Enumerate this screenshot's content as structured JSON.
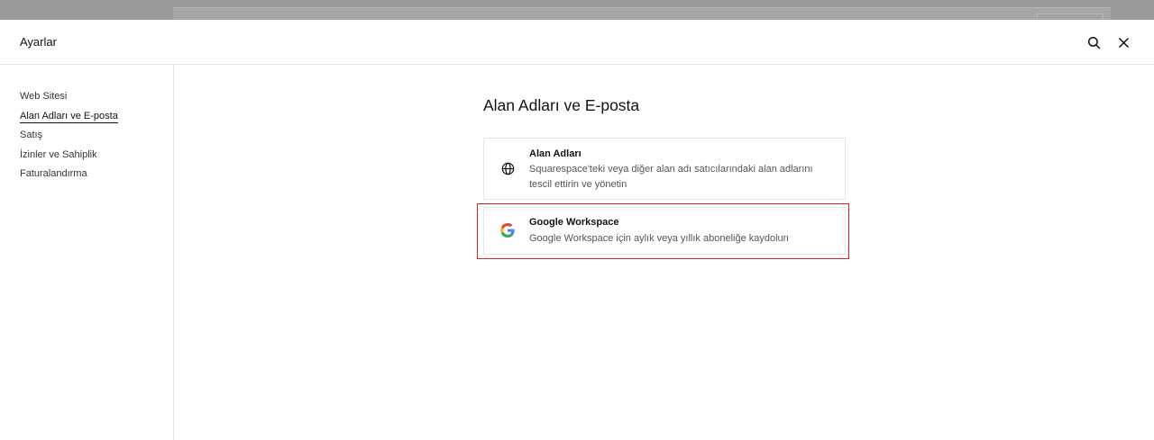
{
  "header": {
    "title": "Ayarlar",
    "search_icon": "search-icon",
    "close_icon": "close-icon"
  },
  "sidebar": {
    "items": [
      {
        "label": "Web Sitesi",
        "active": false
      },
      {
        "label": "Alan Adları ve E-posta",
        "active": true
      },
      {
        "label": "Satış",
        "active": false
      },
      {
        "label": "İzinler ve Sahiplik",
        "active": false
      },
      {
        "label": "Faturalandırma",
        "active": false
      }
    ]
  },
  "main": {
    "title": "Alan Adları ve E-posta",
    "cards": [
      {
        "icon": "globe-icon",
        "title": "Alan Adları",
        "description": "Squarespace'teki veya diğer alan adı satıcılarındaki alan adlarını tescil ettirin ve yönetin"
      },
      {
        "icon": "google-icon",
        "title": "Google Workspace",
        "description": "Google Workspace için aylık veya yıllık aboneliğe kaydolun",
        "highlighted": true
      }
    ]
  },
  "colors": {
    "highlight": "#e02020",
    "text": "#111111",
    "muted": "#555555"
  }
}
